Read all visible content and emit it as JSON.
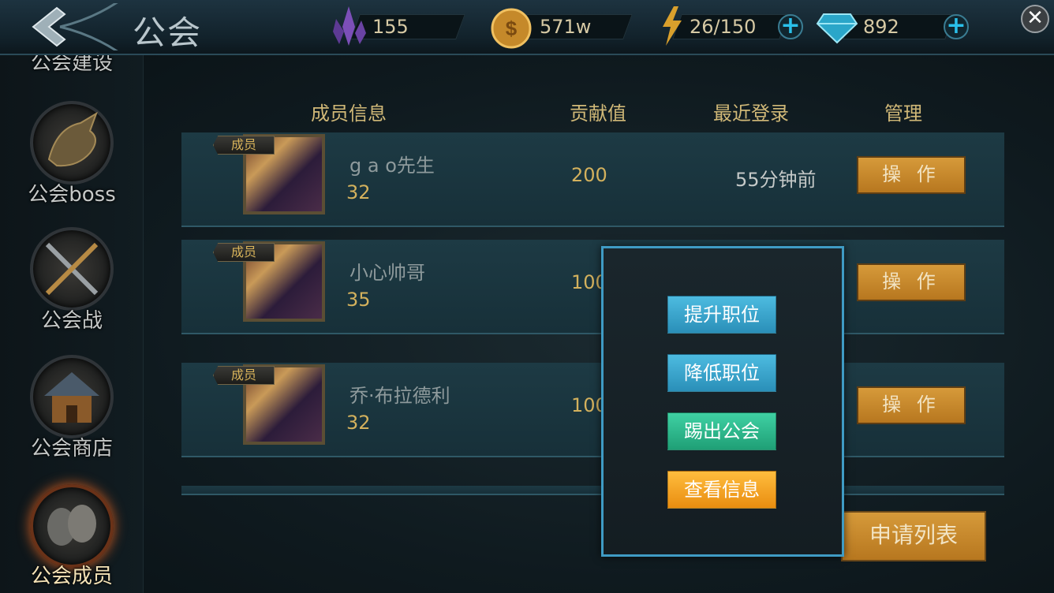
{
  "topbar": {
    "title": "公会",
    "crystal": "155",
    "gold": "571w",
    "stamina": "26/150",
    "diamond": "892"
  },
  "sidebar": {
    "items": [
      {
        "label": "公会建设"
      },
      {
        "label": "公会boss"
      },
      {
        "label": "公会战"
      },
      {
        "label": "公会商店"
      },
      {
        "label": "公会成员"
      }
    ]
  },
  "table": {
    "headers": {
      "info": "成员信息",
      "contribution": "贡献值",
      "last_login": "最近登录",
      "manage": "管理"
    },
    "rows": [
      {
        "badge": "成员",
        "name": "g a o先生",
        "level": "32",
        "contribution": "200",
        "last_login": "55分钟前",
        "action": "操 作"
      },
      {
        "badge": "成员",
        "name": "小心帅哥",
        "level": "35",
        "contribution": "100",
        "last_login": "",
        "action": "操 作"
      },
      {
        "badge": "成员",
        "name": "乔·布拉德利",
        "level": "32",
        "contribution": "100",
        "last_login": "",
        "action": "操 作"
      }
    ]
  },
  "apply_list": "申请列表",
  "popup": {
    "promote": "提升职位",
    "demote": "降低职位",
    "kick": "踢出公会",
    "view": "查看信息"
  },
  "colors": {
    "gold_text": "#d3b15d",
    "popup_border": "#3f9bc4",
    "button_orange": "#c9892c"
  }
}
